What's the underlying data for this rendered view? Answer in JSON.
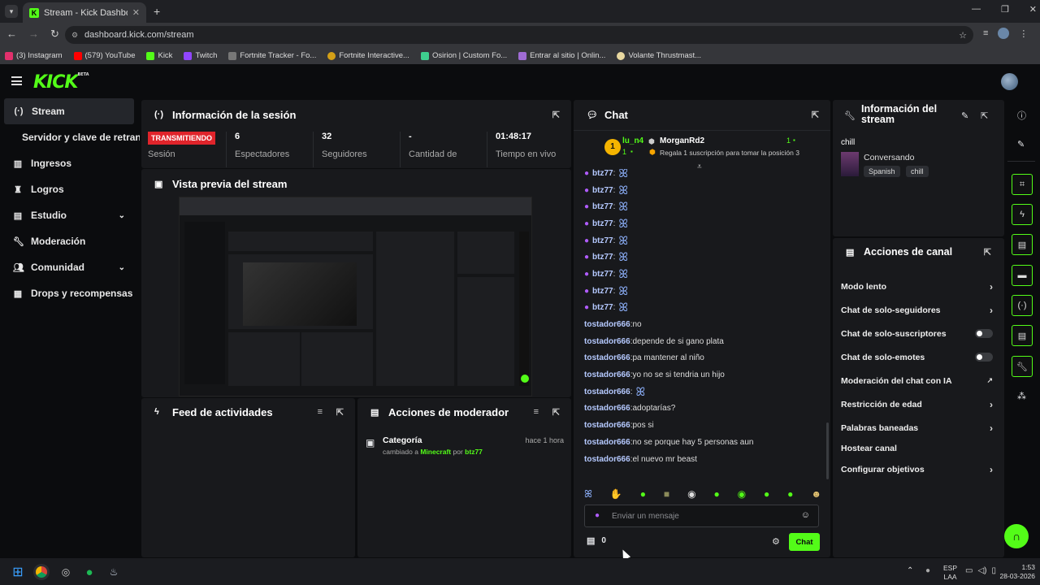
{
  "browser": {
    "tab_title": "Stream - Kick Dashboard",
    "url": "dashboard.kick.com/stream",
    "bookmarks": [
      "(3) Instagram",
      "(579) YouTube",
      "Kick",
      "Twitch",
      "Fortnite Tracker - Fo...",
      "Fortnite Interactive...",
      "Osirion | Custom Fo...",
      "Entrar al sitio | Onlin...",
      "Volante Thrustmast..."
    ],
    "bookmark_colors": [
      "#e1306c",
      "#ff0000",
      "#53fc18",
      "#9146ff",
      "#777777",
      "#d4a017",
      "#3ecf8e",
      "#a06cd5",
      "#e8d8a0"
    ]
  },
  "header": {
    "logo": "KICK",
    "logo_tag": "BETA"
  },
  "sidebar": {
    "items": [
      {
        "label": "Stream",
        "icon": "stream-icon"
      },
      {
        "label": "Servidor y clave de retransmisión",
        "icon": ""
      },
      {
        "label": "Ingresos",
        "icon": "chart-icon"
      },
      {
        "label": "Logros",
        "icon": "trophy-icon"
      },
      {
        "label": "Estudio",
        "icon": "studio-icon"
      },
      {
        "label": "Moderación",
        "icon": "wrench-icon"
      },
      {
        "label": "Comunidad",
        "icon": "people-icon"
      },
      {
        "label": "Drops y recompensas",
        "icon": "gift-icon"
      }
    ]
  },
  "session": {
    "title": "Información de la sesión",
    "status_badge": "TRANSMITIENDO",
    "status_label": "Sesión",
    "stats": [
      {
        "value": "6",
        "label": "Espectadores"
      },
      {
        "value": "32",
        "label": "Seguidores"
      },
      {
        "value": "-",
        "label": "Cantidad de"
      },
      {
        "value": "01:48:17",
        "label": "Tiempo en vivo"
      }
    ]
  },
  "preview": {
    "title": "Vista previa del stream"
  },
  "feed": {
    "title": "Feed de actividades"
  },
  "mod_actions": {
    "title": "Acciones de moderador",
    "item": {
      "title": "Categoría",
      "time": "hace 1 hora",
      "text_pre": "cambiado a",
      "category": "Minecraft",
      "text_by": "por",
      "user": "btz77"
    }
  },
  "chat": {
    "title": "Chat",
    "leader_rank": "1",
    "leader_name": "lu_n4",
    "leader_count": "1",
    "top_user": "MorganRd2",
    "top_count": "1",
    "top_text": "Regala 1 suscripción para tomar la posición 3",
    "messages": [
      {
        "user": "btz77",
        "text": "",
        "emote": true,
        "mic": true
      },
      {
        "user": "btz77",
        "text": "",
        "emote": true,
        "mic": true
      },
      {
        "user": "btz77",
        "text": "",
        "emote": true,
        "mic": true
      },
      {
        "user": "btz77",
        "text": "",
        "emote": true,
        "mic": true
      },
      {
        "user": "btz77",
        "text": "",
        "emote": true,
        "mic": true
      },
      {
        "user": "btz77",
        "text": "",
        "emote": true,
        "mic": true
      },
      {
        "user": "btz77",
        "text": "",
        "emote": true,
        "mic": true
      },
      {
        "user": "btz77",
        "text": "",
        "emote": true,
        "mic": true
      },
      {
        "user": "btz77",
        "text": "",
        "emote": true,
        "mic": true
      },
      {
        "user": "tostador666",
        "text": "no",
        "emote": false,
        "mic": false
      },
      {
        "user": "tostador666",
        "text": "depende de si gano plata",
        "emote": false,
        "mic": false
      },
      {
        "user": "tostador666",
        "text": "pa mantener al niño",
        "emote": false,
        "mic": false
      },
      {
        "user": "tostador666",
        "text": "yo no se si tendria un hijo",
        "emote": false,
        "mic": false
      },
      {
        "user": "tostador666",
        "text": "",
        "emote": true,
        "mic": false
      },
      {
        "user": "tostador666",
        "text": "adoptarías?",
        "emote": false,
        "mic": false
      },
      {
        "user": "tostador666",
        "text": "pos si",
        "emote": false,
        "mic": false
      },
      {
        "user": "tostador666",
        "text": "no se porque hay 5 personas aun",
        "emote": false,
        "mic": false
      },
      {
        "user": "tostador666",
        "text": "el nuevo mr beast",
        "emote": false,
        "mic": false
      }
    ],
    "input_placeholder": "Enviar un mensaje",
    "points": "0",
    "send_label": "Chat"
  },
  "stream_info": {
    "title": "Información del stream",
    "stream_title": "chill",
    "category": "Conversando",
    "tags": [
      "Spanish",
      "chill"
    ]
  },
  "channel_actions": {
    "title": "Acciones de canal",
    "items": [
      {
        "label": "Modo lento",
        "control": "chevron"
      },
      {
        "label": "Chat de solo-seguidores",
        "control": "chevron"
      },
      {
        "label": "Chat de solo-suscriptores",
        "control": "toggle"
      },
      {
        "label": "Chat de solo-emotes",
        "control": "toggle"
      },
      {
        "label": "Moderación del chat con IA",
        "control": "external"
      },
      {
        "label": "Restricción de edad",
        "control": "chevron"
      },
      {
        "label": "Palabras baneadas",
        "control": "chevron"
      },
      {
        "label": "Hostear canal",
        "control": "none"
      },
      {
        "label": "Configurar objetivos",
        "control": "chevron"
      }
    ]
  },
  "taskbar": {
    "lang": "ESP",
    "lang2": "LAA",
    "time": "1:53",
    "date": "28-03-2026"
  }
}
